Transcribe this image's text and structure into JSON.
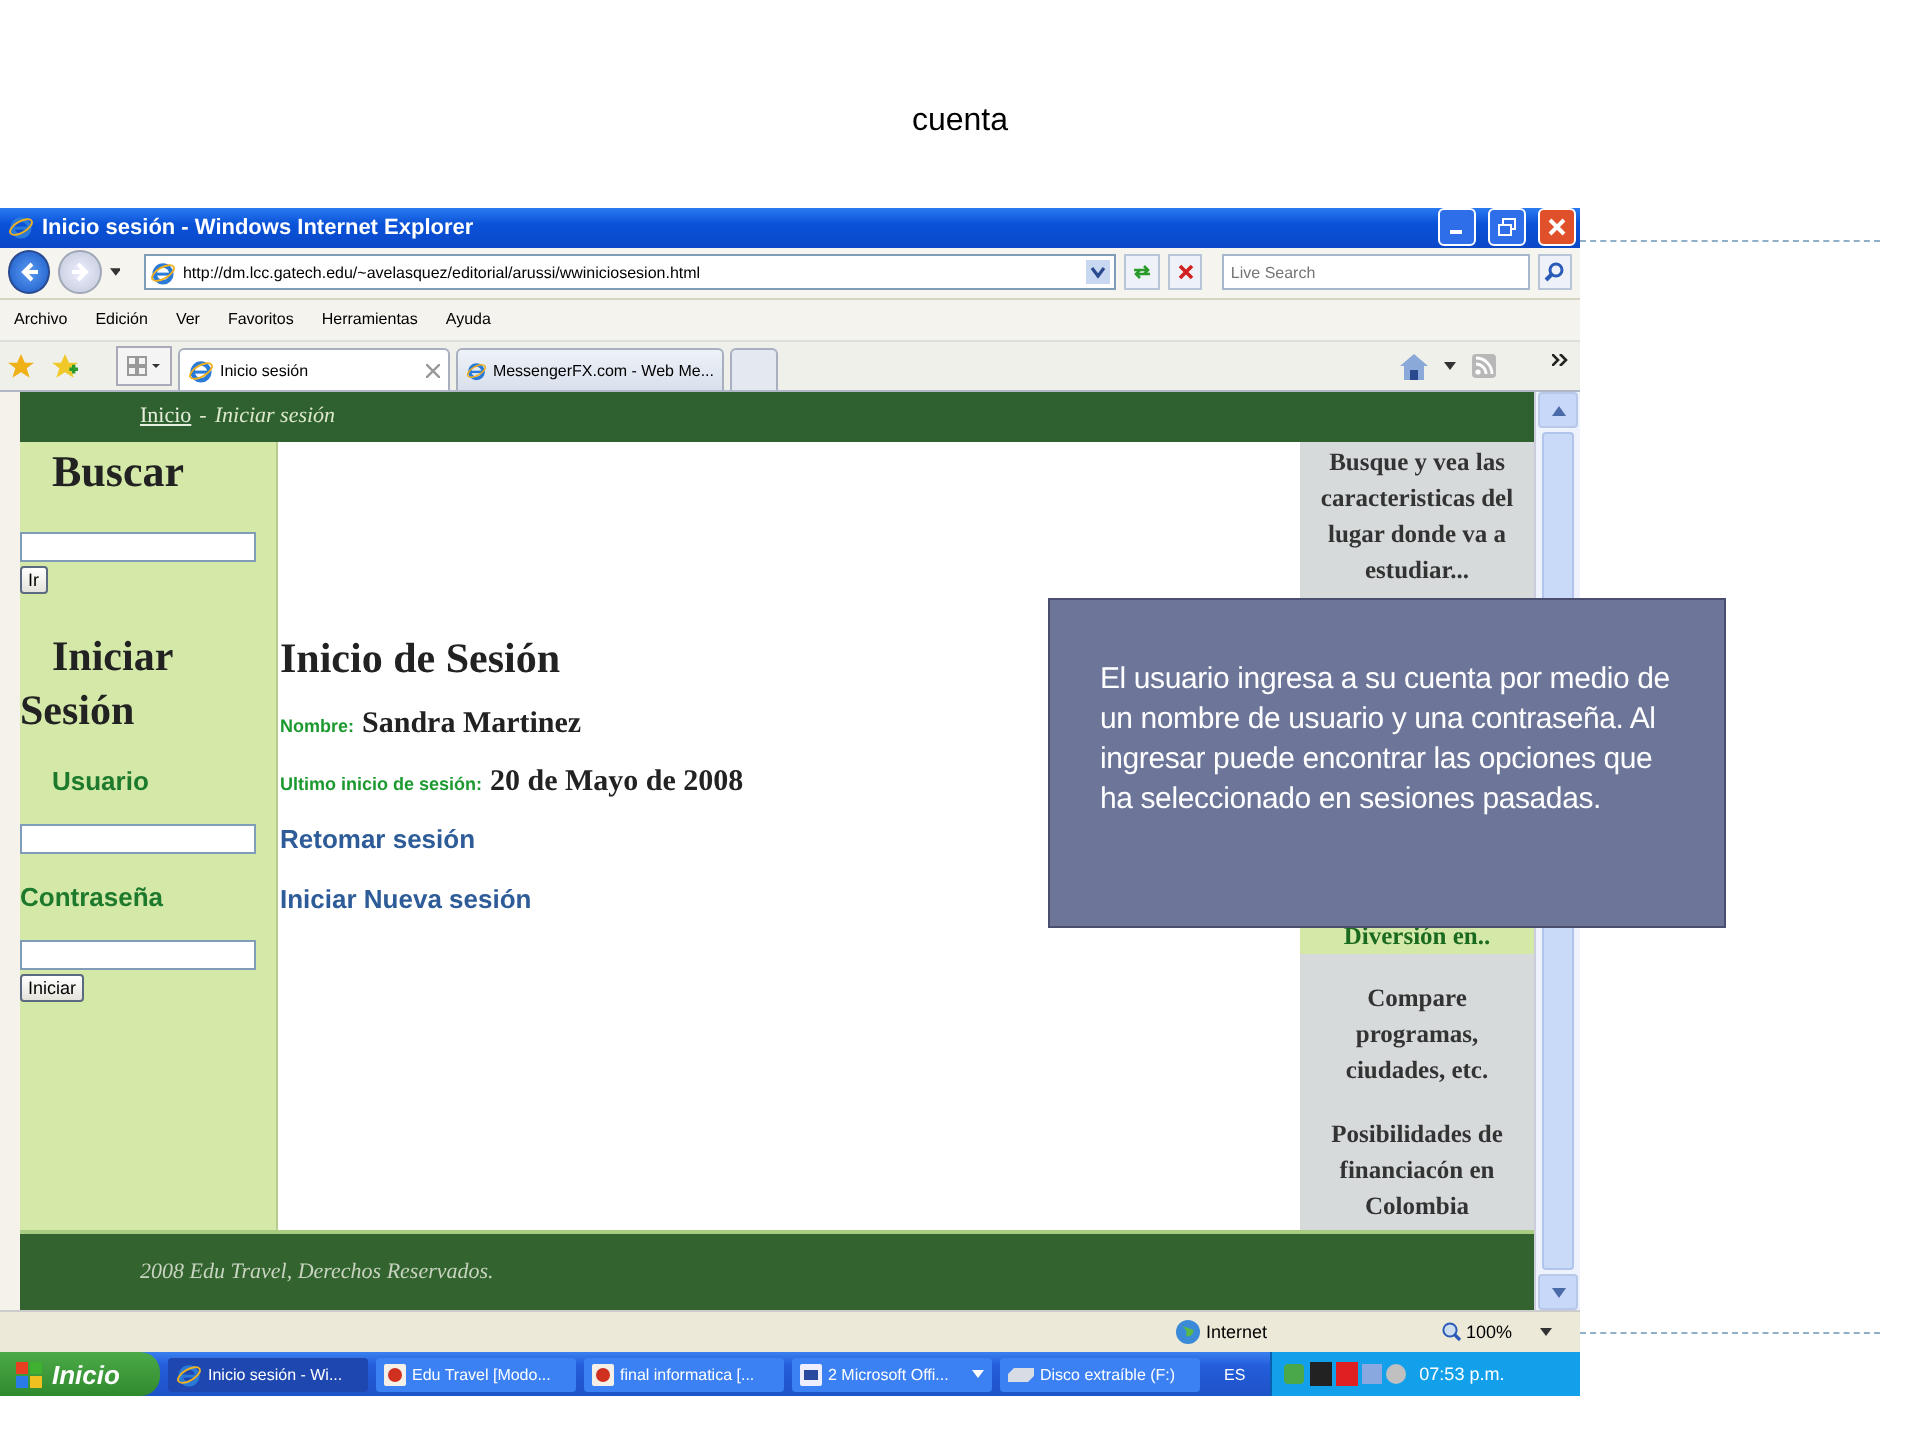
{
  "slide": {
    "title": "cuenta",
    "callout": "El usuario ingresa a su cuenta por medio de un nombre de usuario y una contraseña. Al ingresar puede encontrar las opciones que ha seleccionado en sesiones pasadas."
  },
  "browser": {
    "title": "Inicio sesión - Windows Internet Explorer",
    "address": "http://dm.lcc.gatech.edu/~avelasquez/editorial/arussi/wwiniciosesion.html",
    "search_placeholder": "Live Search",
    "menu": [
      "Archivo",
      "Edición",
      "Ver",
      "Favoritos",
      "Herramientas",
      "Ayuda"
    ],
    "tabs": [
      {
        "label": "Inicio sesión",
        "selected": true
      },
      {
        "label": "MessengerFX.com - Web Me...",
        "selected": false
      }
    ]
  },
  "page": {
    "breadcrumb": {
      "link": "Inicio",
      "separator": "-",
      "current": "Iniciar sesión"
    },
    "left": {
      "search_title": "Buscar",
      "search_button": "Ir",
      "login_title": "Iniciar Sesión",
      "user_label": "Usuario",
      "password_label": "Contraseña",
      "login_button": "Iniciar"
    },
    "main": {
      "title": "Inicio de Sesión",
      "fields": [
        {
          "label": "Nombre:",
          "value": "Sandra Martinez"
        },
        {
          "label": "Ultimo inicio de sesión:",
          "value": "20 de Mayo de 2008"
        }
      ],
      "links": [
        "Retomar sesión",
        "Iniciar Nueva sesión"
      ]
    },
    "right": [
      {
        "text": "Busque y vea las caracteristicas del lugar donde va a estudiar...",
        "highlighted": false
      },
      {
        "text": "Diversión en..",
        "highlighted": true
      },
      {
        "text": "Compare programas, ciudades, etc.",
        "highlighted": false
      },
      {
        "text": "Posibilidades de financiacón en Colombia",
        "highlighted": false
      }
    ],
    "footer": "2008 Edu Travel, Derechos Reservados."
  },
  "status_bar": {
    "zone": "Internet",
    "zoom": "100%"
  },
  "taskbar": {
    "start": "Inicio",
    "items": [
      {
        "label": "Inicio sesión - Wi...",
        "kind": "ie",
        "selected": true
      },
      {
        "label": "Edu Travel [Modo...",
        "kind": "ppt",
        "selected": false
      },
      {
        "label": "final informatica [...",
        "kind": "ppt",
        "selected": false
      },
      {
        "label": "2 Microsoft Offi...",
        "kind": "group",
        "selected": false
      },
      {
        "label": "Disco extraíble (F:)",
        "kind": "drive",
        "selected": false
      }
    ],
    "language": "ES",
    "time": "07:53 p.m."
  }
}
